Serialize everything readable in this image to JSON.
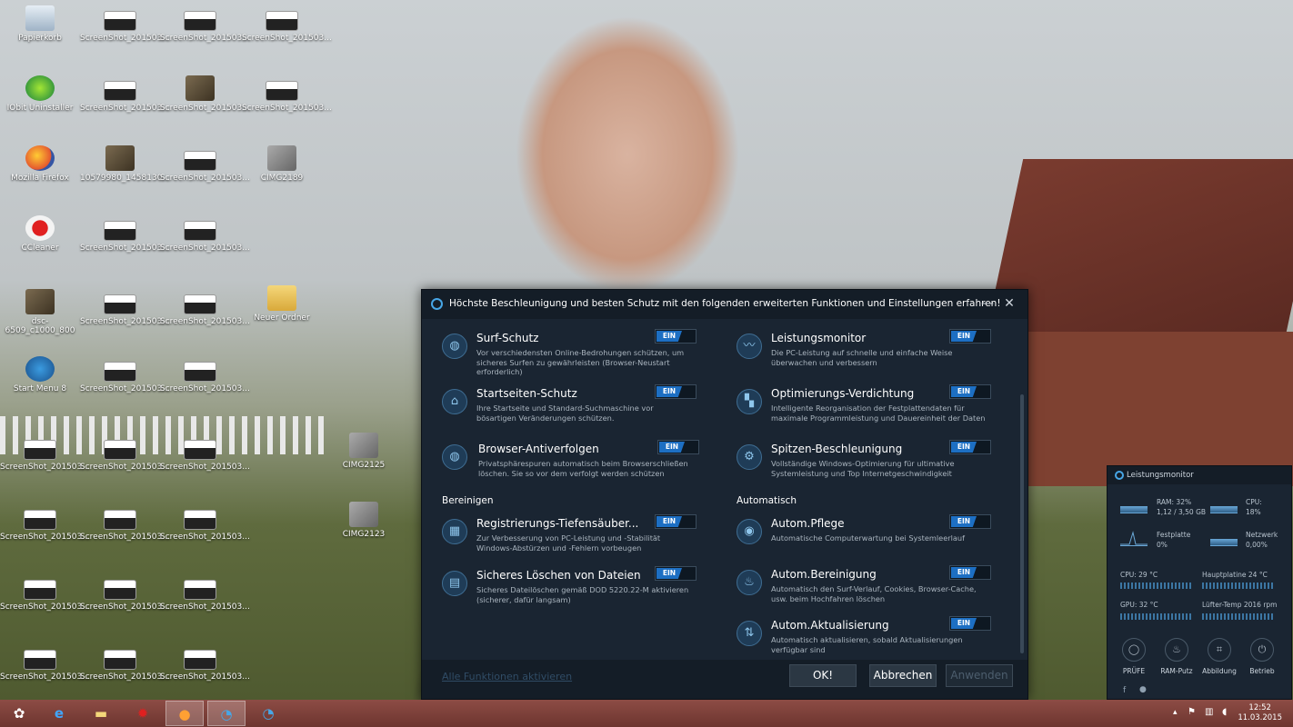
{
  "desktop": {
    "icons": [
      {
        "label": "Papierkorb"
      },
      {
        "label": "ScreenShot_201503..."
      },
      {
        "label": "ScreenShot_201503..."
      },
      {
        "label": "ScreenShot_201503..."
      },
      {
        "label": "IObit Uninstaller"
      },
      {
        "label": "ScreenShot_201503..."
      },
      {
        "label": "ScreenShot_201503..."
      },
      {
        "label": "ScreenShot_201503..."
      },
      {
        "label": "Mozilla Firefox"
      },
      {
        "label": "10579980_1458130..."
      },
      {
        "label": "ScreenShot_201503..."
      },
      {
        "label": "CIMG2189"
      },
      {
        "label": "CCleaner"
      },
      {
        "label": "ScreenShot_201503..."
      },
      {
        "label": "ScreenShot_201503..."
      },
      {
        "label": "dsc-6509_c1000_800"
      },
      {
        "label": "ScreenShot_201503..."
      },
      {
        "label": "ScreenShot_201503..."
      },
      {
        "label": "Neuer Ordner"
      },
      {
        "label": "Start Menu 8"
      },
      {
        "label": "ScreenShot_201503..."
      },
      {
        "label": "ScreenShot_201503..."
      },
      {
        "label": "ScreenShot_201503..."
      },
      {
        "label": "ScreenShot_201503..."
      },
      {
        "label": "ScreenShot_201503..."
      },
      {
        "label": "CIMG2125"
      },
      {
        "label": "ScreenShot_201503..."
      },
      {
        "label": "ScreenShot_201503..."
      },
      {
        "label": "ScreenShot_201503..."
      },
      {
        "label": "CIMG2123"
      },
      {
        "label": "ScreenShot_201503..."
      },
      {
        "label": "ScreenShot_201503..."
      },
      {
        "label": "ScreenShot_201503..."
      },
      {
        "label": "ScreenShot_201503..."
      },
      {
        "label": "ScreenShot_201503..."
      },
      {
        "label": "ScreenShot_201503..."
      }
    ]
  },
  "dialog": {
    "title": "Höchste Beschleunigung und besten Schutz mit den folgenden erweiterten Funktionen und Einstellungen erfahren!",
    "minimize": "—",
    "close": "✕",
    "toggle_label": "EIN",
    "sections": {
      "clean": "Bereinigen",
      "auto": "Automatisch"
    },
    "features": {
      "surf": {
        "name": "Surf-Schutz",
        "desc": "Vor verschiedensten Online-Bedrohungen schützen, um sicheres Surfen zu gewährleisten (Browser-Neustart erforderlich)"
      },
      "start": {
        "name": "Startseiten-Schutz",
        "desc": "Ihre Startseite und Standard-Suchmaschine vor bösartigen Veränderungen schützen."
      },
      "anti": {
        "name": "Browser-Antiverfolgen",
        "desc": "Privatsphärespuren automatisch beim Browserschließen löschen. Sie so vor dem verfolgt werden schützen"
      },
      "perf": {
        "name": "Leistungsmonitor",
        "desc": "Die PC-Leistung auf schnelle und einfache Weise überwachen und verbessern"
      },
      "defrag": {
        "name": "Optimierungs-Verdichtung",
        "desc": "Intelligente Reorganisation der Festplattendaten für maximale Programmleistung und Dauereinheit der Daten"
      },
      "turbo": {
        "name": "Spitzen-Beschleunigung",
        "desc": "Vollständige Windows-Optimierung für ultimative Systemleistung und Top Internetgeschwindigkeit"
      },
      "reg": {
        "name": "Registrierungs-Tiefensäuber...",
        "desc": "Zur Verbesserung von PC-Leistung und -Stabilität Windows-Abstürzen und -Fehlern vorbeugen"
      },
      "shred": {
        "name": "Sicheres Löschen von Dateien",
        "desc": "Sicheres Dateilöschen gemäß DOD 5220.22-M aktivieren (sicherer, dafür langsam)"
      },
      "care": {
        "name": "Autom.Pflege",
        "desc": "Automatische Computerwartung bei Systemleerlauf"
      },
      "clean": {
        "name": "Autom.Bereinigung",
        "desc": "Automatisch den Surf-Verlauf, Cookies, Browser-Cache, usw. beim Hochfahren löschen"
      },
      "update": {
        "name": "Autom.Aktualisierung",
        "desc": "Automatisch aktualisieren, sobald Aktualisierungen verfügbar sind"
      }
    },
    "footer": {
      "enable_all": "Alle Funktionen aktivieren",
      "ok": "OK!",
      "cancel": "Abbrechen",
      "apply": "Anwenden"
    }
  },
  "perfmon": {
    "title": "Leistungsmonitor",
    "ram_label": "RAM: 32%",
    "ram_value": "1,12 / 3,50 GB",
    "cpu_label": "CPU:",
    "cpu_value": "18%",
    "disk_label": "Festplatte",
    "disk_value": "0%",
    "net_label": "Netzwerk",
    "net_value": "0,00%",
    "cpu_temp": "CPU:  29 °C",
    "board_temp": "Hauptplatine  24 °C",
    "gpu_temp": "GPU:  32 °C",
    "fan": "Lüfter-Temp  2016 rpm",
    "buttons": {
      "check": "PRÜFE",
      "ram": "RAM-Putz",
      "shot": "Abbildung",
      "mode": "Betrieb"
    }
  },
  "taskbar": {
    "time": "12:52",
    "date": "11.03.2015"
  }
}
